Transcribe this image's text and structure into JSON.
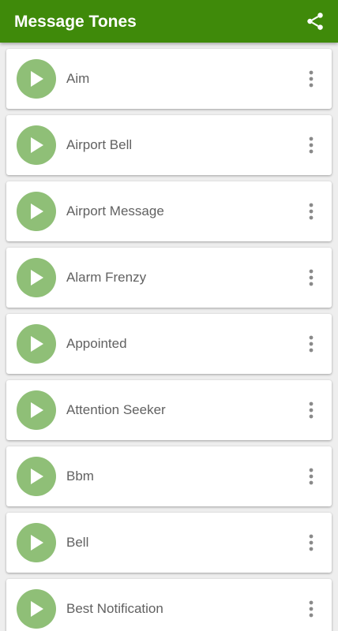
{
  "appbar": {
    "title": "Message Tones",
    "share_icon": "share-icon",
    "color": "#3f8a0a"
  },
  "tones": {
    "play_icon": "play-icon",
    "more_icon": "more-vertical-icon",
    "play_color": "#8fbf77",
    "items": [
      {
        "label": "Aim"
      },
      {
        "label": "Airport Bell"
      },
      {
        "label": "Airport Message"
      },
      {
        "label": "Alarm Frenzy"
      },
      {
        "label": "Appointed"
      },
      {
        "label": "Attention Seeker"
      },
      {
        "label": "Bbm"
      },
      {
        "label": "Bell"
      },
      {
        "label": "Best Notification"
      }
    ]
  }
}
